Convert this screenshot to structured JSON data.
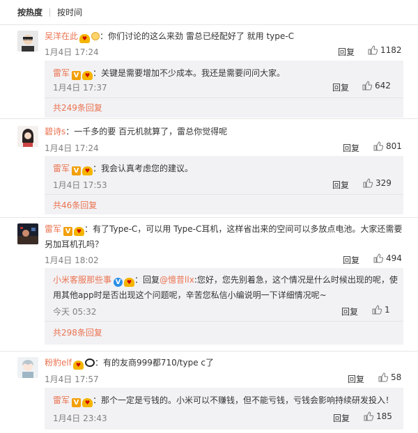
{
  "tabs": {
    "hot": "按热度",
    "time": "按时间"
  },
  "reply_label": "回复",
  "colors": {
    "name": "#eb7350",
    "bg_sub": "#f2f2f5"
  },
  "comments": [
    {
      "name": "吴洋在此",
      "text": "：你们讨论的这么来劲 雷总已经配好了 就用 type-C",
      "time": "1月4日 17:24",
      "likes": "1182",
      "reply": {
        "name": "雷军",
        "text": "：关键是需要增加不少成本。我还是需要问问大家。",
        "time": "1月4日 17:37",
        "likes": "642"
      },
      "more": "共249条回复"
    },
    {
      "name": "碧诗s",
      "text": "：一千多的要 百元机就算了，雷总你觉得呢",
      "time": "1月4日 17:24",
      "likes": "801",
      "reply": {
        "name": "雷军",
        "text": "：我会认真考虑您的建议。",
        "time": "1月4日 17:53",
        "likes": "329"
      },
      "more": "共46条回复"
    },
    {
      "name": "雷军",
      "text": "：有了Type-C，可以用 Type-C耳机，这样省出来的空间可以多放点电池。大家还需要另加耳机孔吗？",
      "time": "1月4日 18:02",
      "likes": "494",
      "reply": {
        "name": "小米客服那些事",
        "prefix": "：回复",
        "mention": "@憶昔llx",
        "text": ":您好，您先别着急，这个情况是什么时候出现的呢，使用其他app时是否出现这个问题呢，辛苦您私信小编说明一下详细情况呢~",
        "time": "今天 05:32",
        "likes": "1"
      },
      "more": "共298条回复"
    },
    {
      "name": "粉豹elf",
      "text": "：有的友商999都710/type c了",
      "time": "1月4日 17:57",
      "likes": "58",
      "reply": {
        "name": "雷军",
        "text": "：那个一定是亏钱的。小米可以不赚钱，但不能亏钱，亏钱会影响持续研发投入！",
        "time": "1月4日 23:43",
        "likes": "185"
      }
    }
  ]
}
